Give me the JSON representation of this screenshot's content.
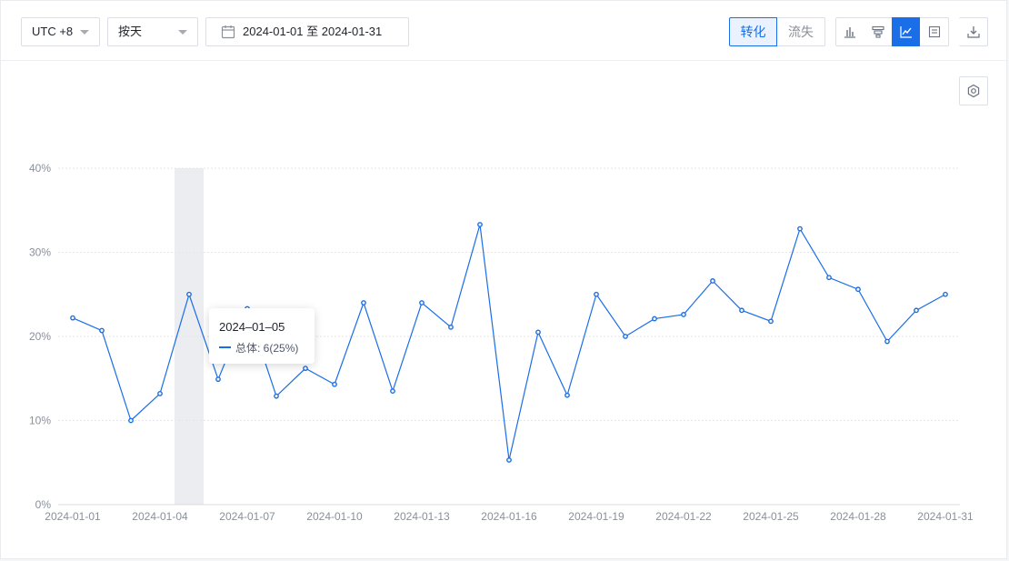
{
  "toolbar": {
    "timezone": "UTC +8",
    "granularity": "按天",
    "date_start": "2024-01-01",
    "date_sep": "至",
    "date_end": "2024-01-31",
    "tab_convert": "转化",
    "tab_churn": "流失"
  },
  "icons": {
    "timezone_caret": "chevron-down-icon",
    "granularity_caret": "chevron-down-icon",
    "date": "calendar-icon",
    "view_bar": "bar-chart-icon",
    "view_funnel": "funnel-icon",
    "view_line": "line-chart-icon",
    "view_table": "table-icon",
    "download": "download-icon",
    "settings": "gear-icon"
  },
  "colors": {
    "accent": "#1a6ee8",
    "highlight_band": "#ebedf0",
    "grid": "#e5e6eb",
    "axis_text": "#8a8f99"
  },
  "tooltip": {
    "date": "2024–01–05",
    "series_label": "总体",
    "value_text": ": 6(25%)"
  },
  "chart_data": {
    "type": "line",
    "x": [
      "2024-01-01",
      "2024-01-02",
      "2024-01-03",
      "2024-01-04",
      "2024-01-05",
      "2024-01-06",
      "2024-01-07",
      "2024-01-08",
      "2024-01-09",
      "2024-01-10",
      "2024-01-11",
      "2024-01-12",
      "2024-01-13",
      "2024-01-14",
      "2024-01-15",
      "2024-01-16",
      "2024-01-17",
      "2024-01-18",
      "2024-01-19",
      "2024-01-20",
      "2024-01-21",
      "2024-01-22",
      "2024-01-23",
      "2024-01-24",
      "2024-01-25",
      "2024-01-26",
      "2024-01-27",
      "2024-01-28",
      "2024-01-29",
      "2024-01-30",
      "2024-01-31"
    ],
    "x_tick_labels": [
      "2024-01-01",
      "2024-01-04",
      "2024-01-07",
      "2024-01-10",
      "2024-01-13",
      "2024-01-16",
      "2024-01-19",
      "2024-01-22",
      "2024-01-25",
      "2024-01-28",
      "2024-01-31"
    ],
    "series": [
      {
        "name": "总体",
        "values": [
          22.2,
          20.7,
          10.0,
          13.2,
          25.0,
          14.9,
          23.3,
          12.9,
          16.2,
          14.3,
          24.0,
          13.5,
          24.0,
          21.1,
          33.3,
          5.3,
          20.5,
          13.0,
          25.0,
          20.0,
          22.1,
          22.6,
          26.6,
          23.1,
          21.8,
          32.8,
          27.0,
          25.6,
          19.4,
          23.1,
          25.0
        ]
      }
    ],
    "highlight_x": "2024-01-05",
    "y_tick_labels": [
      "0%",
      "10%",
      "20%",
      "30%",
      "40%"
    ],
    "ylim": [
      0,
      40
    ],
    "title": "",
    "xlabel": "",
    "ylabel": "",
    "grid": true
  }
}
